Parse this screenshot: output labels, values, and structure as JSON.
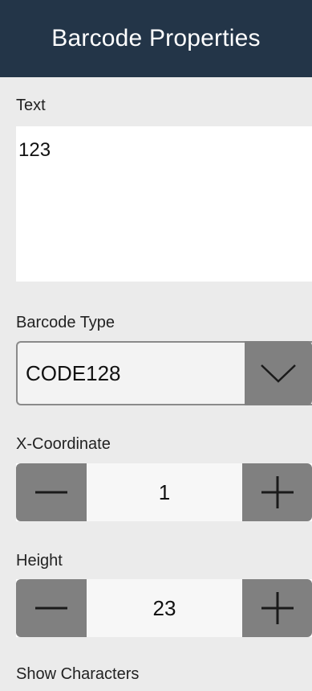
{
  "header": {
    "title": "Barcode Properties"
  },
  "text_field": {
    "label": "Text",
    "value": "123"
  },
  "barcode_type": {
    "label": "Barcode Type",
    "selected": "CODE128",
    "icon": "chevron-down-icon"
  },
  "x_coordinate": {
    "label": "X-Coordinate",
    "value": "1"
  },
  "height": {
    "label": "Height",
    "value": "23"
  },
  "show_characters": {
    "label": "Show Characters"
  },
  "colors": {
    "header_bg": "#233548",
    "panel_bg": "#ebebeb",
    "button_bg": "#808080"
  }
}
